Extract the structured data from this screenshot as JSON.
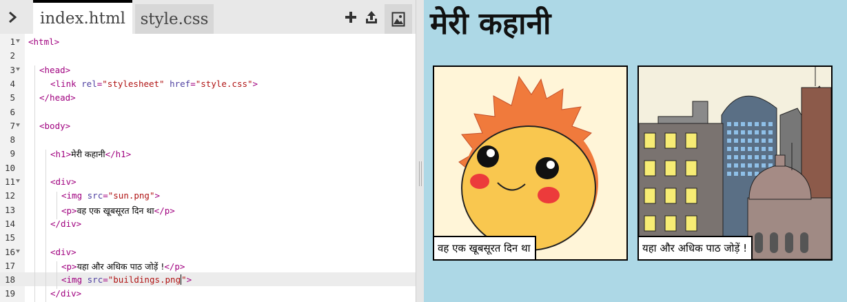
{
  "editor": {
    "tabs": [
      {
        "label": "index.html"
      },
      {
        "label": "style.css"
      }
    ],
    "lines": [
      {
        "n": "1",
        "tokens": [
          [
            "tg",
            "<html>"
          ]
        ]
      },
      {
        "n": "2",
        "tokens": []
      },
      {
        "n": "3",
        "tokens": [
          [
            "tg",
            "<head>"
          ]
        ]
      },
      {
        "n": "4",
        "tokens": [
          [
            "tg",
            "<link "
          ],
          [
            "at",
            "rel"
          ],
          [
            "tg",
            "="
          ],
          [
            "st",
            "\"stylesheet\""
          ],
          [
            "tg",
            " "
          ],
          [
            "at",
            "href"
          ],
          [
            "tg",
            "="
          ],
          [
            "st",
            "\"style.css\""
          ],
          [
            "tg",
            ">"
          ]
        ]
      },
      {
        "n": "5",
        "tokens": [
          [
            "tg",
            "</head>"
          ]
        ]
      },
      {
        "n": "6",
        "tokens": []
      },
      {
        "n": "7",
        "tokens": [
          [
            "tg",
            "<body>"
          ]
        ]
      },
      {
        "n": "8",
        "tokens": []
      },
      {
        "n": "9",
        "tokens": [
          [
            "tg",
            "<h1>"
          ],
          [
            "tx",
            "मेरी कहानी"
          ],
          [
            "tg",
            "</h1>"
          ]
        ]
      },
      {
        "n": "10",
        "tokens": []
      },
      {
        "n": "11",
        "tokens": [
          [
            "tg",
            "<div>"
          ]
        ]
      },
      {
        "n": "12",
        "tokens": [
          [
            "tg",
            "<img "
          ],
          [
            "at",
            "src"
          ],
          [
            "tg",
            "="
          ],
          [
            "st",
            "\"sun.png\""
          ],
          [
            "tg",
            ">"
          ]
        ]
      },
      {
        "n": "13",
        "tokens": [
          [
            "tg",
            "<p>"
          ],
          [
            "tx",
            "वह एक खूबसूरत दिन था"
          ],
          [
            "tg",
            "</p>"
          ]
        ]
      },
      {
        "n": "14",
        "tokens": [
          [
            "tg",
            "</div>"
          ]
        ]
      },
      {
        "n": "15",
        "tokens": []
      },
      {
        "n": "16",
        "tokens": [
          [
            "tg",
            "<div>"
          ]
        ]
      },
      {
        "n": "17",
        "tokens": [
          [
            "tg",
            "<p>"
          ],
          [
            "tx",
            "यहा और अधिक पाठ जोड़ें !"
          ],
          [
            "tg",
            "</p>"
          ]
        ]
      },
      {
        "n": "18",
        "tokens": [
          [
            "tg",
            "<img "
          ],
          [
            "at",
            "src"
          ],
          [
            "tg",
            "="
          ],
          [
            "st",
            "\"buildings.png"
          ],
          [
            "cursor",
            ""
          ],
          [
            "st",
            "\""
          ],
          [
            "tg",
            ">"
          ]
        ]
      },
      {
        "n": "19",
        "tokens": [
          [
            "tg",
            "</div>"
          ]
        ]
      }
    ]
  },
  "preview": {
    "heading": "मेरी कहानी",
    "panels": [
      {
        "caption": "वह एक खूबसूरत दिन था",
        "image": "sun"
      },
      {
        "caption": "यहा और अधिक पाठ जोड़ें !",
        "image": "buildings"
      }
    ]
  }
}
